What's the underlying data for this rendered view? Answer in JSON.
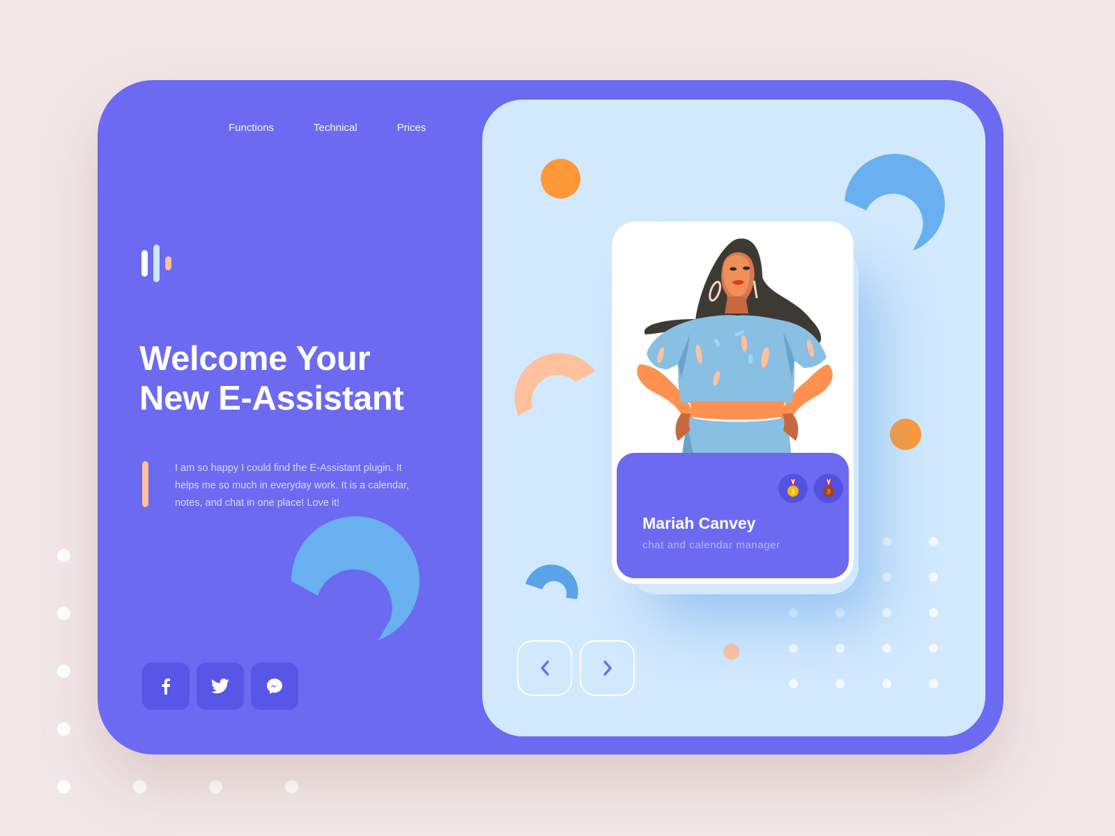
{
  "nav": {
    "items": [
      {
        "label": "Functions"
      },
      {
        "label": "Technical"
      },
      {
        "label": "Prices"
      }
    ]
  },
  "logo": {
    "icon": "sound-bars-logo"
  },
  "hero": {
    "title_line1": "Welcome Your",
    "title_line2": "New E-Assistant",
    "testimonial": "I am so happy I could find the E-Assistant plugin. It helps me so much in everyday work. It is a calendar, notes, and chat in one place! Love it!"
  },
  "socials": [
    {
      "name": "facebook",
      "icon": "facebook-icon"
    },
    {
      "name": "twitter",
      "icon": "twitter-icon"
    },
    {
      "name": "messenger",
      "icon": "messenger-icon"
    }
  ],
  "profile_card": {
    "name": "Mariah Canvey",
    "role": "chat and calendar manager",
    "badges": [
      {
        "icon": "gold-medal-icon",
        "rank": "1"
      },
      {
        "icon": "bronze-medal-icon",
        "rank": "3"
      }
    ]
  },
  "pager": {
    "prev_icon": "chevron-left-icon",
    "next_icon": "chevron-right-icon"
  },
  "colors": {
    "page_bg": "#f2e7e7",
    "primary": "#6b6af0",
    "primary_dark": "#5756e6",
    "panel_bg": "#d2e9fd",
    "accent_orange": "#ff9836",
    "accent_peach": "#ffc09c",
    "accent_blue": "#68b0f0"
  }
}
